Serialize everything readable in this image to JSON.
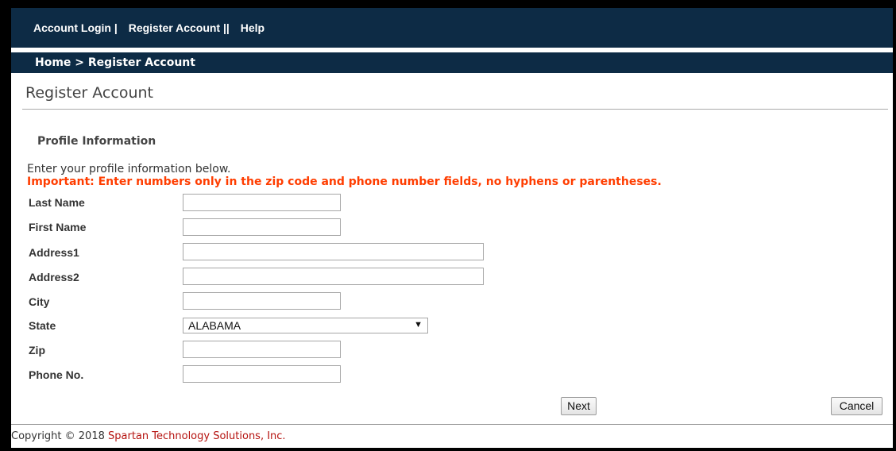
{
  "nav": {
    "account_login": "Account Login",
    "sep1": "|",
    "register_account": "Register Account",
    "sep2": "||",
    "help": "Help"
  },
  "breadcrumb": "Home > Register Account",
  "page_title": "Register Account",
  "section_title": "Profile Information",
  "intro_text": "Enter your profile information below.",
  "important_text": "Important: Enter numbers only in the zip code and phone number fields, no hyphens or parentheses.",
  "form": {
    "last_name": {
      "label": "Last Name",
      "value": ""
    },
    "first_name": {
      "label": "First Name",
      "value": ""
    },
    "address1": {
      "label": "Address1",
      "value": ""
    },
    "address2": {
      "label": "Address2",
      "value": ""
    },
    "city": {
      "label": "City",
      "value": ""
    },
    "state": {
      "label": "State",
      "value": "ALABAMA"
    },
    "zip": {
      "label": "Zip",
      "value": ""
    },
    "phone": {
      "label": "Phone No.",
      "value": ""
    }
  },
  "buttons": {
    "next": "Next",
    "cancel": "Cancel"
  },
  "footer": {
    "prefix": "Copyright © 2018 ",
    "company": "Spartan Technology Solutions, Inc."
  },
  "colors": {
    "nav_bg": "#0d2b45",
    "important": "#ff3d00",
    "company": "#b5120f"
  },
  "icons": {
    "state_dropdown": "triangle-down-icon"
  }
}
